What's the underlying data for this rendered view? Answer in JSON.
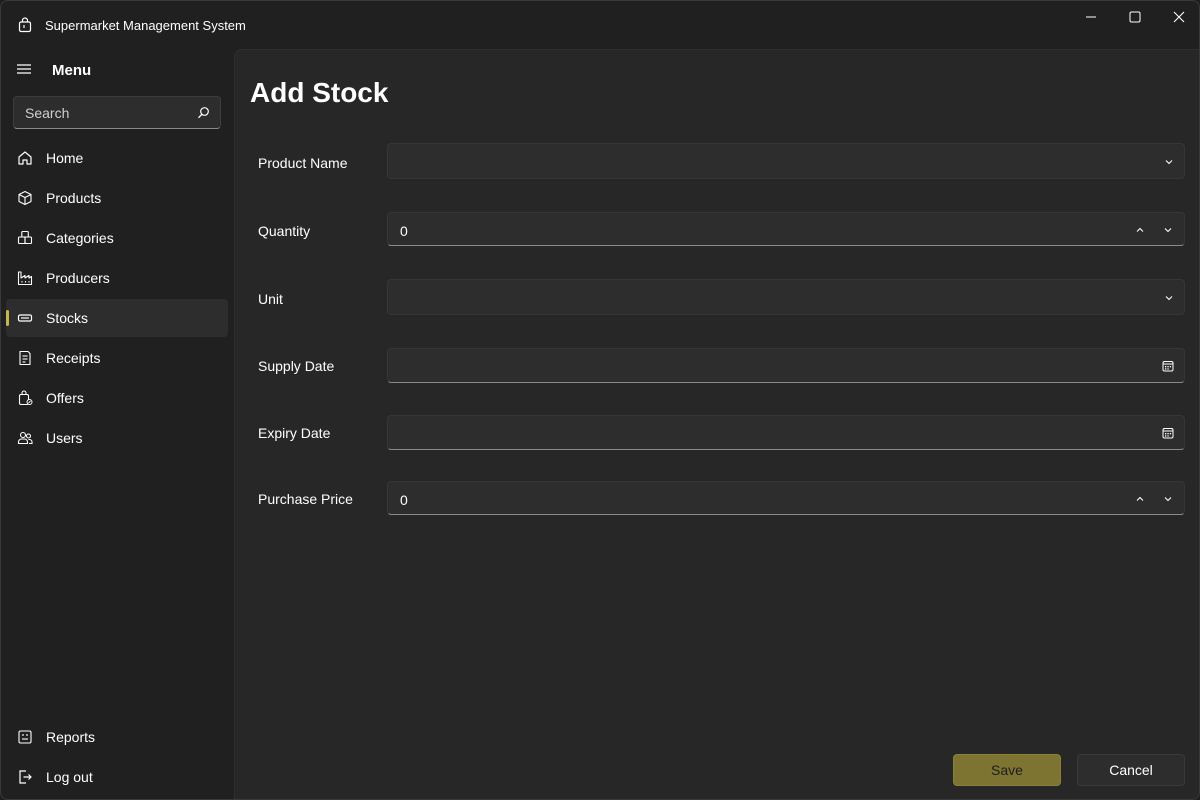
{
  "window": {
    "title": "Supermarket Management System"
  },
  "sidebar": {
    "menu_label": "Menu",
    "search": {
      "placeholder": "Search"
    },
    "items": [
      {
        "label": "Home",
        "icon": "home-icon"
      },
      {
        "label": "Products",
        "icon": "box-icon"
      },
      {
        "label": "Categories",
        "icon": "boxes-icon"
      },
      {
        "label": "Producers",
        "icon": "factory-icon"
      },
      {
        "label": "Stocks",
        "icon": "stock-icon",
        "selected": true
      },
      {
        "label": "Receipts",
        "icon": "receipt-icon"
      },
      {
        "label": "Offers",
        "icon": "offer-icon"
      },
      {
        "label": "Users",
        "icon": "users-icon"
      }
    ],
    "footer_items": [
      {
        "label": "Reports",
        "icon": "report-icon"
      },
      {
        "label": "Log out",
        "icon": "logout-icon"
      }
    ]
  },
  "main": {
    "title": "Add Stock",
    "fields": {
      "product_name": {
        "label": "Product Name",
        "value": ""
      },
      "quantity": {
        "label": "Quantity",
        "value": "0"
      },
      "unit": {
        "label": "Unit",
        "value": ""
      },
      "supply_date": {
        "label": "Supply Date",
        "value": ""
      },
      "expiry_date": {
        "label": "Expiry Date",
        "value": ""
      },
      "purchase_price": {
        "label": "Purchase Price",
        "value": "0"
      }
    },
    "buttons": {
      "save": "Save",
      "cancel": "Cancel"
    }
  },
  "colors": {
    "accent": "#c9b64a",
    "save_button": "#7d7432",
    "background": "#202020",
    "content_background": "#272727"
  }
}
